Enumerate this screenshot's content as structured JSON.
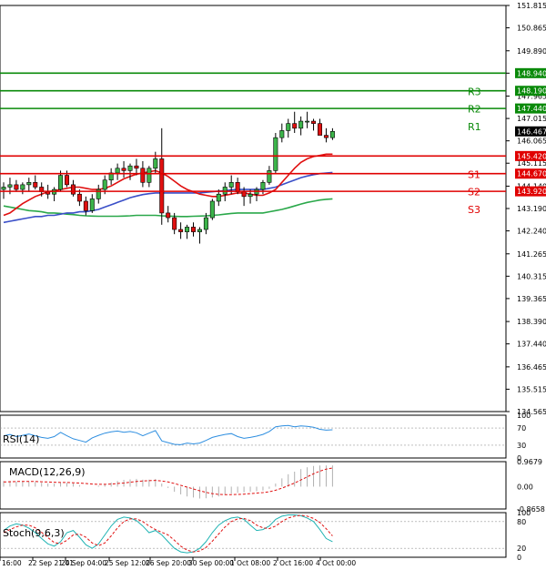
{
  "chart_data": {
    "type": "candlestick",
    "price_axis": {
      "ylim": [
        134.565,
        151.815
      ],
      "ticks": [
        "151.815",
        "150.865",
        "149.890",
        "148.940",
        "147.965",
        "147.015",
        "146.065",
        "145.115",
        "144.140",
        "143.190",
        "142.240",
        "141.265",
        "140.315",
        "139.365",
        "138.390",
        "137.440",
        "136.465",
        "135.515",
        "134.565"
      ]
    },
    "x_labels": [
      "16:00",
      "22 Sep 21:01",
      "24 Sep 04:00",
      "25 Sep 12:00",
      "26 Sep 20:00",
      "30 Sep 00:00",
      "1 Oct 08:00",
      "2 Oct 16:00",
      "4 Oct 00:00"
    ],
    "current_price": "146.467",
    "levels": [
      {
        "name": "R3",
        "value": 148.94,
        "label": "148.940",
        "color": "#0a8a0a"
      },
      {
        "name": "R2",
        "value": 148.19,
        "label": "148.190",
        "color": "#0a8a0a"
      },
      {
        "name": "R1",
        "value": 147.44,
        "label": "147.440",
        "color": "#0a8a0a"
      },
      {
        "name": "S1",
        "value": 145.42,
        "label": "145.420",
        "color": "#e00000"
      },
      {
        "name": "S2",
        "value": 144.67,
        "label": "144.670",
        "color": "#e00000"
      },
      {
        "name": "S3",
        "value": 143.92,
        "label": "143.920",
        "color": "#e00000"
      }
    ],
    "candles": [
      [
        144.0,
        144.3,
        143.6,
        144.1
      ],
      [
        144.1,
        144.5,
        143.8,
        144.2
      ],
      [
        144.2,
        144.4,
        143.9,
        144.0
      ],
      [
        144.0,
        144.3,
        143.8,
        144.2
      ],
      [
        144.2,
        144.5,
        143.9,
        144.3
      ],
      [
        144.3,
        144.6,
        144.0,
        144.1
      ],
      [
        144.1,
        144.3,
        143.7,
        143.9
      ],
      [
        143.9,
        144.2,
        143.6,
        143.8
      ],
      [
        143.8,
        144.1,
        143.5,
        144.0
      ],
      [
        144.0,
        144.8,
        143.9,
        144.6
      ],
      [
        144.6,
        144.8,
        144.1,
        144.2
      ],
      [
        144.2,
        144.4,
        143.7,
        143.8
      ],
      [
        143.8,
        144.0,
        143.3,
        143.5
      ],
      [
        143.5,
        143.7,
        142.9,
        143.1
      ],
      [
        143.1,
        143.8,
        143.0,
        143.6
      ],
      [
        143.6,
        144.2,
        143.4,
        144.0
      ],
      [
        144.0,
        144.6,
        143.8,
        144.4
      ],
      [
        144.4,
        144.9,
        144.2,
        144.7
      ],
      [
        144.7,
        145.1,
        144.4,
        144.9
      ],
      [
        144.9,
        145.2,
        144.5,
        144.8
      ],
      [
        144.8,
        145.1,
        144.4,
        145.0
      ],
      [
        145.0,
        145.3,
        144.6,
        144.9
      ],
      [
        144.9,
        145.2,
        144.1,
        144.3
      ],
      [
        144.3,
        145.0,
        144.1,
        144.9
      ],
      [
        144.9,
        145.6,
        144.7,
        145.3
      ],
      [
        145.3,
        146.6,
        142.5,
        143.0
      ],
      [
        143.0,
        143.3,
        142.6,
        142.8
      ],
      [
        142.8,
        143.0,
        142.1,
        142.3
      ],
      [
        142.3,
        142.6,
        141.9,
        142.2
      ],
      [
        142.2,
        142.5,
        141.9,
        142.4
      ],
      [
        142.4,
        142.6,
        142.0,
        142.2
      ],
      [
        142.2,
        142.4,
        141.7,
        142.3
      ],
      [
        142.3,
        143.0,
        142.1,
        142.8
      ],
      [
        142.8,
        143.6,
        142.7,
        143.5
      ],
      [
        143.5,
        144.0,
        143.3,
        143.8
      ],
      [
        143.8,
        144.3,
        143.5,
        144.1
      ],
      [
        144.1,
        144.6,
        143.8,
        144.3
      ],
      [
        144.3,
        144.5,
        143.8,
        143.9
      ],
      [
        143.9,
        144.1,
        143.3,
        143.7
      ],
      [
        143.7,
        144.0,
        143.4,
        143.8
      ],
      [
        143.8,
        144.1,
        143.5,
        144.0
      ],
      [
        144.0,
        144.4,
        143.8,
        144.3
      ],
      [
        144.3,
        145.0,
        144.2,
        144.8
      ],
      [
        144.8,
        146.4,
        144.7,
        146.2
      ],
      [
        146.2,
        146.8,
        146.0,
        146.5
      ],
      [
        146.5,
        147.0,
        146.2,
        146.8
      ],
      [
        146.8,
        147.3,
        146.4,
        146.6
      ],
      [
        146.6,
        147.1,
        146.3,
        146.9
      ],
      [
        146.9,
        147.3,
        146.6,
        146.9
      ],
      [
        146.9,
        147.0,
        146.5,
        146.8
      ],
      [
        146.8,
        147.0,
        146.4,
        146.3
      ],
      [
        146.3,
        146.6,
        146.0,
        146.2
      ],
      [
        146.2,
        146.6,
        146.1,
        146.467
      ]
    ],
    "ma_red": [
      142.9,
      143.0,
      143.2,
      143.4,
      143.55,
      143.7,
      143.8,
      143.9,
      143.95,
      144.0,
      144.05,
      144.1,
      144.1,
      144.05,
      144.0,
      144.0,
      144.05,
      144.15,
      144.3,
      144.45,
      144.55,
      144.65,
      144.7,
      144.75,
      144.8,
      144.7,
      144.55,
      144.35,
      144.15,
      144.0,
      143.9,
      143.8,
      143.75,
      143.7,
      143.7,
      143.75,
      143.8,
      143.85,
      143.85,
      143.8,
      143.75,
      143.75,
      143.85,
      144.0,
      144.3,
      144.6,
      144.9,
      145.15,
      145.3,
      145.4,
      145.45,
      145.5,
      145.5
    ],
    "ma_blue": [
      142.6,
      142.65,
      142.7,
      142.75,
      142.8,
      142.85,
      142.85,
      142.9,
      142.9,
      142.95,
      143.0,
      143.0,
      143.05,
      143.05,
      143.1,
      143.15,
      143.25,
      143.35,
      143.45,
      143.55,
      143.65,
      143.72,
      143.78,
      143.82,
      143.85,
      143.85,
      143.85,
      143.85,
      143.85,
      143.85,
      143.85,
      143.85,
      143.88,
      143.9,
      143.93,
      143.95,
      143.98,
      144.0,
      144.0,
      144.0,
      144.0,
      144.0,
      144.05,
      144.1,
      144.2,
      144.3,
      144.4,
      144.5,
      144.57,
      144.63,
      144.67,
      144.7,
      144.72
    ],
    "ma_green": [
      143.3,
      143.25,
      143.2,
      143.15,
      143.1,
      143.08,
      143.05,
      143.0,
      143.0,
      142.98,
      142.95,
      142.93,
      142.9,
      142.88,
      142.87,
      142.86,
      142.86,
      142.86,
      142.86,
      142.87,
      142.88,
      142.9,
      142.9,
      142.9,
      142.9,
      142.88,
      142.87,
      142.86,
      142.85,
      142.85,
      142.86,
      142.87,
      142.88,
      142.9,
      142.92,
      142.95,
      142.98,
      143.0,
      143.0,
      143.0,
      143.0,
      143.0,
      143.05,
      143.1,
      143.15,
      143.22,
      143.3,
      143.38,
      143.45,
      143.5,
      143.55,
      143.58,
      143.6
    ],
    "rsi": {
      "label": "RSI(14)",
      "ticks": [
        "100",
        "70",
        "30",
        "0"
      ],
      "values": [
        52,
        55,
        50,
        53,
        56,
        52,
        48,
        46,
        50,
        60,
        52,
        45,
        41,
        37,
        47,
        53,
        58,
        61,
        63,
        60,
        62,
        59,
        52,
        58,
        64,
        40,
        36,
        32,
        31,
        35,
        33,
        35,
        41,
        48,
        52,
        55,
        57,
        50,
        46,
        48,
        51,
        55,
        62,
        73,
        75,
        76,
        73,
        75,
        74,
        72,
        67,
        65,
        66
      ]
    },
    "macd": {
      "label": "MACD(12,26,9)",
      "ticks": [
        "0.9679",
        "0.00",
        "-0.8658"
      ],
      "histogram": [
        0.22,
        0.22,
        0.2,
        0.2,
        0.2,
        0.18,
        0.15,
        0.12,
        0.12,
        0.15,
        0.15,
        0.12,
        0.06,
        0.0,
        0.0,
        0.04,
        0.1,
        0.16,
        0.22,
        0.26,
        0.28,
        0.3,
        0.27,
        0.27,
        0.3,
        0.12,
        -0.05,
        -0.2,
        -0.3,
        -0.38,
        -0.42,
        -0.46,
        -0.45,
        -0.42,
        -0.38,
        -0.32,
        -0.27,
        -0.24,
        -0.22,
        -0.2,
        -0.18,
        -0.15,
        -0.08,
        0.12,
        0.32,
        0.48,
        0.58,
        0.68,
        0.75,
        0.8,
        0.82,
        0.82,
        0.82
      ],
      "signal": [
        0.18,
        0.19,
        0.2,
        0.2,
        0.2,
        0.2,
        0.19,
        0.18,
        0.17,
        0.16,
        0.16,
        0.15,
        0.14,
        0.12,
        0.1,
        0.09,
        0.09,
        0.1,
        0.12,
        0.14,
        0.17,
        0.2,
        0.22,
        0.23,
        0.24,
        0.22,
        0.18,
        0.12,
        0.05,
        -0.02,
        -0.09,
        -0.16,
        -0.22,
        -0.27,
        -0.3,
        -0.31,
        -0.31,
        -0.3,
        -0.29,
        -0.27,
        -0.25,
        -0.23,
        -0.2,
        -0.14,
        -0.06,
        0.04,
        0.14,
        0.26,
        0.38,
        0.5,
        0.6,
        0.68,
        0.72
      ]
    },
    "stoch": {
      "label": "Stoch(9,6,3)",
      "ticks": [
        "100",
        "80",
        "20",
        "0"
      ],
      "main": [
        60,
        70,
        75,
        72,
        65,
        55,
        42,
        30,
        25,
        35,
        55,
        60,
        45,
        28,
        20,
        30,
        50,
        70,
        85,
        90,
        88,
        82,
        70,
        55,
        60,
        50,
        35,
        20,
        12,
        10,
        12,
        20,
        35,
        55,
        72,
        82,
        88,
        90,
        85,
        72,
        60,
        62,
        70,
        85,
        92,
        95,
        95,
        93,
        88,
        80,
        62,
        42,
        35
      ],
      "signal": [
        55,
        62,
        68,
        72,
        72,
        66,
        56,
        44,
        33,
        30,
        38,
        50,
        52,
        45,
        32,
        26,
        32,
        48,
        66,
        80,
        86,
        86,
        80,
        70,
        62,
        56,
        50,
        38,
        25,
        16,
        12,
        14,
        22,
        36,
        52,
        68,
        80,
        86,
        87,
        82,
        72,
        66,
        64,
        70,
        80,
        88,
        92,
        94,
        92,
        87,
        78,
        64,
        48
      ]
    }
  }
}
